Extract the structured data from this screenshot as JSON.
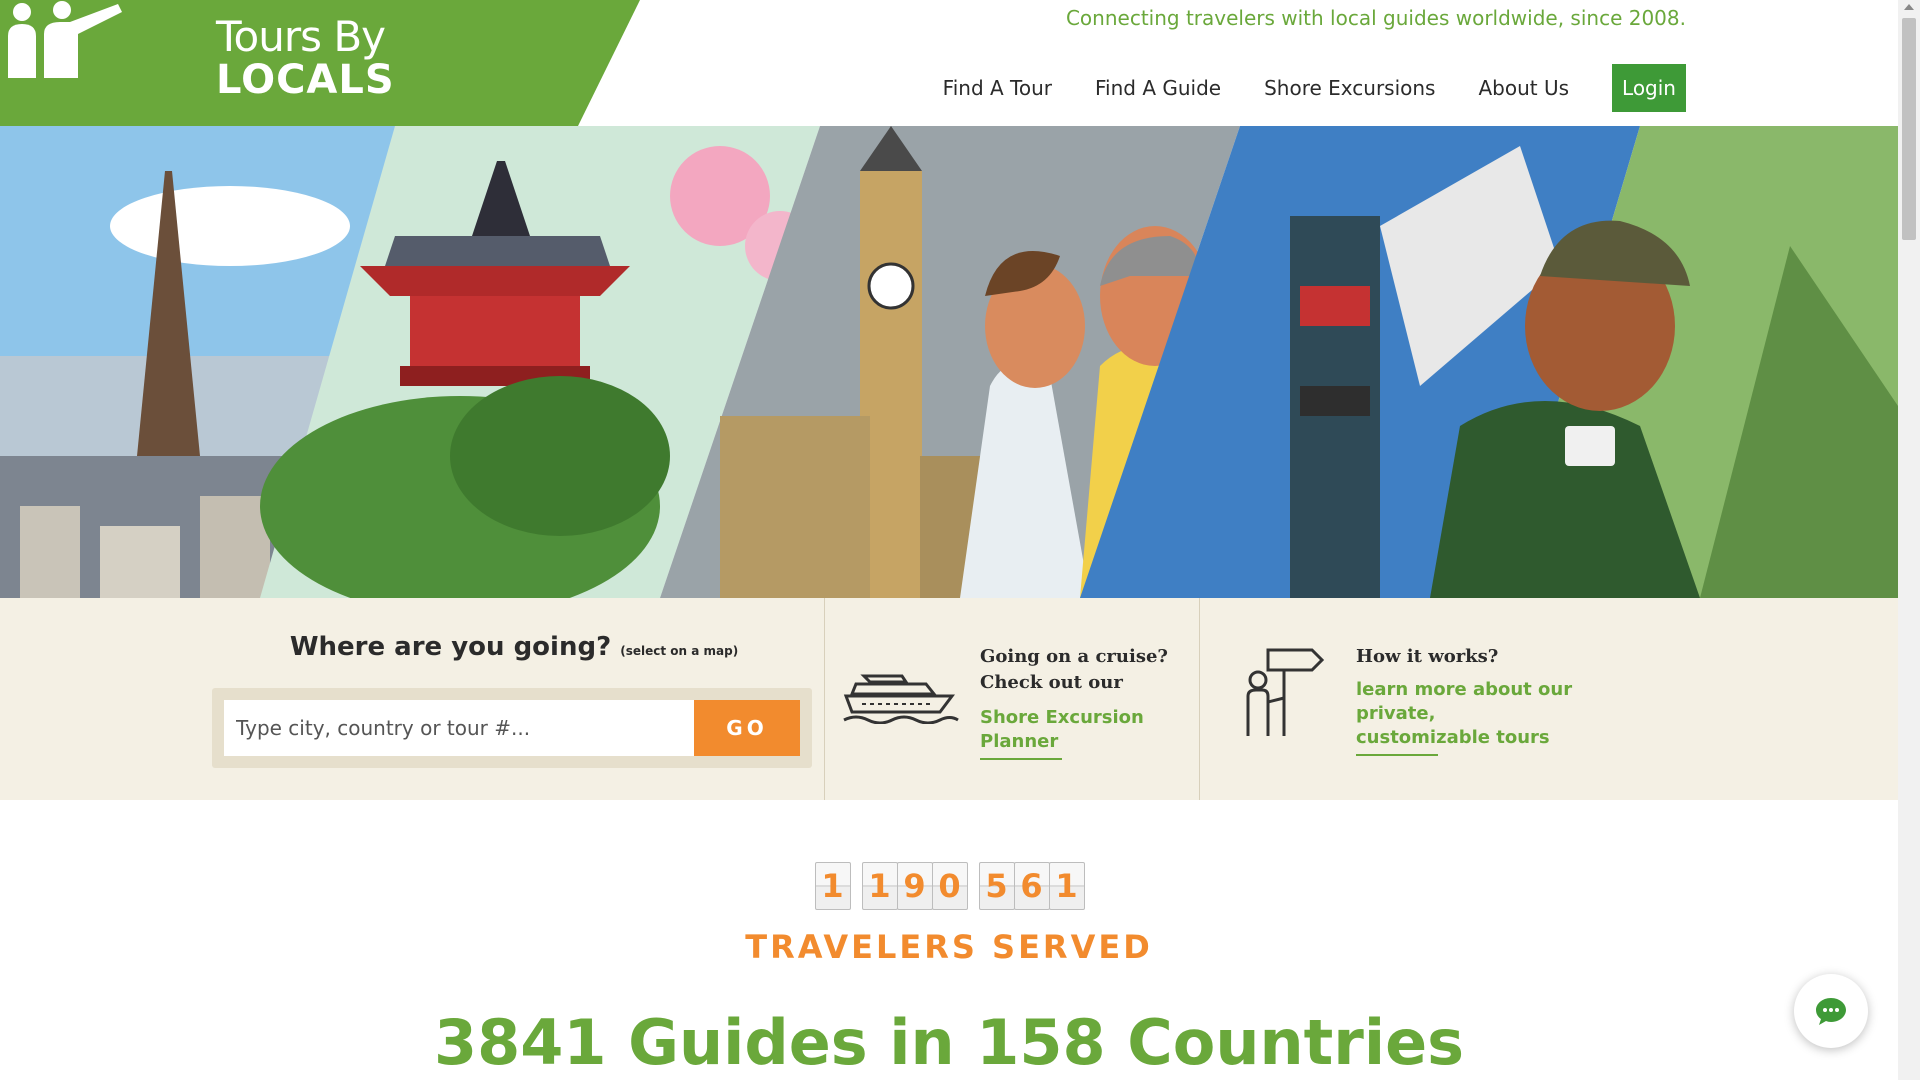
{
  "brand": {
    "name_line1": "Tours By",
    "name_line2": "LOCALS",
    "tagline": "Connecting travelers with local guides worldwide, since 2008.",
    "colors": {
      "green": "#6aa83b",
      "dark_green": "#3e9a37",
      "orange": "#f28b2e",
      "beige": "#f4f0e4"
    }
  },
  "nav": {
    "items": [
      {
        "label": "Find A Tour"
      },
      {
        "label": "Find A Guide"
      },
      {
        "label": "Shore Excursions"
      },
      {
        "label": "About Us"
      }
    ],
    "login_label": "Login"
  },
  "search": {
    "title": "Where are you going?",
    "subtitle": "(select on a map)",
    "placeholder": "Type city, country or tour #...",
    "go_label": "GO"
  },
  "cruise": {
    "icon": "cruise-ship-icon",
    "heading_line1": "Going on a cruise?",
    "heading_line2": "Check out our",
    "link_line1": "Shore Excursion",
    "link_line2": "Planner"
  },
  "how": {
    "icon": "guide-sign-icon",
    "heading": "How it works?",
    "link_line1": "learn more about our",
    "link_line2": "private,",
    "link_line3": "customizable tours"
  },
  "stats": {
    "counter_groups": [
      [
        "1"
      ],
      [
        "1",
        "9",
        "0"
      ],
      [
        "5",
        "6",
        "1"
      ]
    ],
    "travelers_label": "TRAVELERS SERVED",
    "guides_headline": "3841 Guides in 158 Countries"
  },
  "chat": {
    "icon": "chat-bubble-icon"
  }
}
